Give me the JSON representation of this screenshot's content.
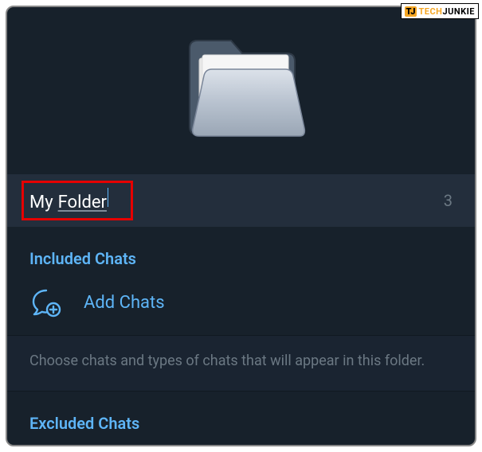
{
  "watermark": {
    "badge": "TJ",
    "part1": "TECH",
    "part2": "JUNKIE"
  },
  "folder": {
    "name_word1": "My",
    "name_word2": "Folder",
    "count": "3"
  },
  "included": {
    "header": "Included Chats",
    "add_label": "Add Chats",
    "hint": "Choose chats and types of chats that will appear in this folder."
  },
  "excluded": {
    "header": "Excluded Chats"
  }
}
